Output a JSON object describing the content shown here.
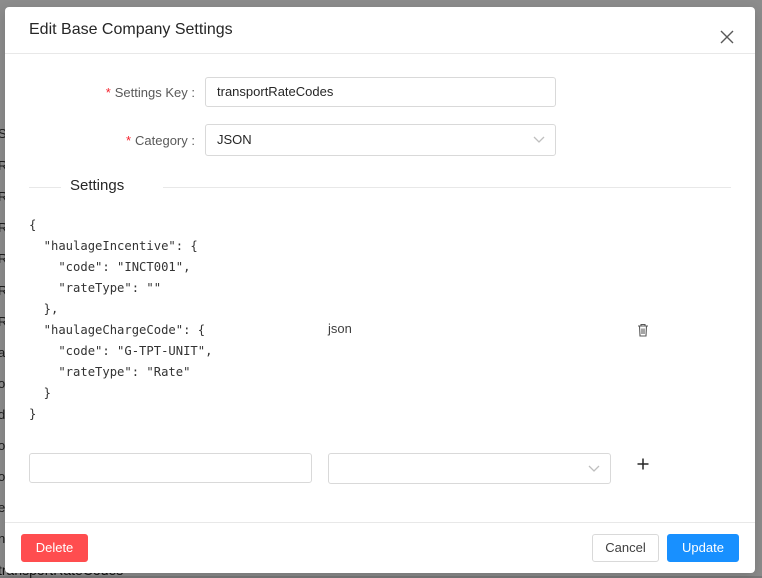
{
  "background": {
    "left_chars": [
      "S",
      "R",
      "R",
      "R",
      "R",
      "R",
      "R",
      "a",
      "o",
      "d",
      "o",
      "o",
      "e",
      "n"
    ],
    "bottom_text": "transportRateCodes"
  },
  "modal": {
    "title": "Edit Base Company Settings",
    "close_icon": "close-icon",
    "fields": {
      "settings_key": {
        "label": "Settings Key",
        "value": "transportRateCodes",
        "required": true
      },
      "category": {
        "label": "Category",
        "value": "JSON",
        "required": true
      }
    },
    "settings_section": {
      "title": "Settings",
      "entries": [
        {
          "value": "{\n  \"haulageIncentive\": {\n    \"code\": \"INCT001\",\n    \"rateType\": \"\"\n  },\n  \"haulageChargeCode\": {\n    \"code\": \"G-TPT-UNIT\",\n    \"rateType\": \"Rate\"\n  }\n}",
          "type": "json"
        }
      ],
      "new_entry": {
        "value": "",
        "type": ""
      }
    },
    "footer": {
      "delete_label": "Delete",
      "cancel_label": "Cancel",
      "update_label": "Update"
    }
  },
  "colors": {
    "danger": "#ff4d4f",
    "primary": "#1890ff",
    "required": "#f5222d"
  }
}
